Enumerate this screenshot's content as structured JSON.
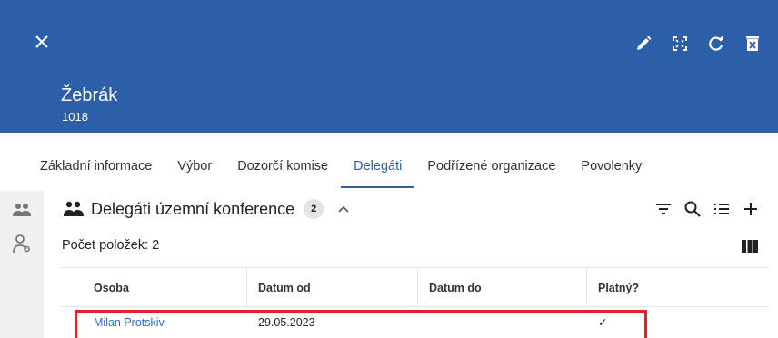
{
  "header": {
    "title": "Žebrák",
    "subtitle": "1018",
    "actions": [
      "pencil-icon",
      "fullscreen-icon",
      "refresh-icon",
      "delete-icon"
    ],
    "background": "#2d5fa8"
  },
  "tabs": [
    {
      "label": "Základní informace",
      "active": false
    },
    {
      "label": "Výbor",
      "active": false
    },
    {
      "label": "Dozorčí komise",
      "active": false
    },
    {
      "label": "Delegáti",
      "active": true
    },
    {
      "label": "Podřízené organizace",
      "active": false
    },
    {
      "label": "Povolenky",
      "active": false
    }
  ],
  "panel": {
    "title": "Delegáti územní konference",
    "count": "2",
    "count_line": "Počet položek: 2"
  },
  "table": {
    "headers": [
      "Osoba",
      "Datum od",
      "Datum do",
      "Platný?"
    ],
    "rows": [
      {
        "osoba": "Milan Protskiv",
        "datum_od": "29.05.2023",
        "datum_do": "",
        "platny": "✓"
      }
    ]
  },
  "colors": {
    "accent": "#2d5fa8",
    "link": "#2d6dc3",
    "highlight": "#e0202a"
  }
}
